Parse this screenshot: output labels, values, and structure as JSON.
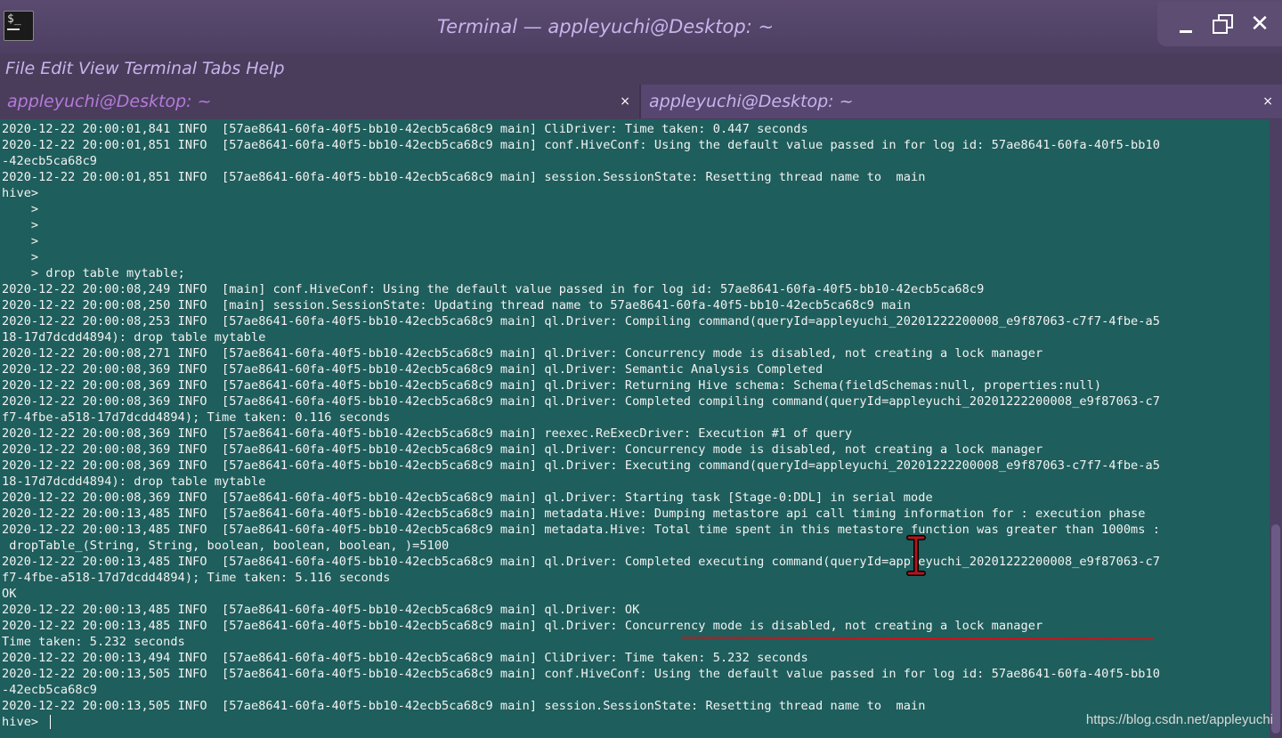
{
  "window": {
    "title": "Terminal — appleyuchi@Desktop: ~",
    "controls": {
      "minimize": "minimize",
      "maximize": "maximize",
      "close": "✕"
    }
  },
  "menu": [
    "File",
    "Edit",
    "View",
    "Terminal",
    "Tabs",
    "Help"
  ],
  "tabs": [
    {
      "label": "appleyuchi@Desktop: ~",
      "close": "×",
      "active": true
    },
    {
      "label": "appleyuchi@Desktop: ~",
      "close": "×",
      "active": false
    }
  ],
  "terminal": {
    "lines": [
      "2020-12-22 20:00:01,841 INFO  [57ae8641-60fa-40f5-bb10-42ecb5ca68c9 main] CliDriver: Time taken: 0.447 seconds",
      "2020-12-22 20:00:01,851 INFO  [57ae8641-60fa-40f5-bb10-42ecb5ca68c9 main] conf.HiveConf: Using the default value passed in for log id: 57ae8641-60fa-40f5-bb10",
      "-42ecb5ca68c9",
      "2020-12-22 20:00:01,851 INFO  [57ae8641-60fa-40f5-bb10-42ecb5ca68c9 main] session.SessionState: Resetting thread name to  main",
      "hive>",
      "    >",
      "    >",
      "    >",
      "    >",
      "    > drop table mytable;",
      "2020-12-22 20:00:08,249 INFO  [main] conf.HiveConf: Using the default value passed in for log id: 57ae8641-60fa-40f5-bb10-42ecb5ca68c9",
      "2020-12-22 20:00:08,250 INFO  [main] session.SessionState: Updating thread name to 57ae8641-60fa-40f5-bb10-42ecb5ca68c9 main",
      "2020-12-22 20:00:08,253 INFO  [57ae8641-60fa-40f5-bb10-42ecb5ca68c9 main] ql.Driver: Compiling command(queryId=appleyuchi_20201222200008_e9f87063-c7f7-4fbe-a5",
      "18-17d7dcdd4894): drop table mytable",
      "2020-12-22 20:00:08,271 INFO  [57ae8641-60fa-40f5-bb10-42ecb5ca68c9 main] ql.Driver: Concurrency mode is disabled, not creating a lock manager",
      "2020-12-22 20:00:08,369 INFO  [57ae8641-60fa-40f5-bb10-42ecb5ca68c9 main] ql.Driver: Semantic Analysis Completed",
      "2020-12-22 20:00:08,369 INFO  [57ae8641-60fa-40f5-bb10-42ecb5ca68c9 main] ql.Driver: Returning Hive schema: Schema(fieldSchemas:null, properties:null)",
      "2020-12-22 20:00:08,369 INFO  [57ae8641-60fa-40f5-bb10-42ecb5ca68c9 main] ql.Driver: Completed compiling command(queryId=appleyuchi_20201222200008_e9f87063-c7",
      "f7-4fbe-a518-17d7dcdd4894); Time taken: 0.116 seconds",
      "2020-12-22 20:00:08,369 INFO  [57ae8641-60fa-40f5-bb10-42ecb5ca68c9 main] reexec.ReExecDriver: Execution #1 of query",
      "2020-12-22 20:00:08,369 INFO  [57ae8641-60fa-40f5-bb10-42ecb5ca68c9 main] ql.Driver: Concurrency mode is disabled, not creating a lock manager",
      "2020-12-22 20:00:08,369 INFO  [57ae8641-60fa-40f5-bb10-42ecb5ca68c9 main] ql.Driver: Executing command(queryId=appleyuchi_20201222200008_e9f87063-c7f7-4fbe-a5",
      "18-17d7dcdd4894): drop table mytable",
      "2020-12-22 20:00:08,369 INFO  [57ae8641-60fa-40f5-bb10-42ecb5ca68c9 main] ql.Driver: Starting task [Stage-0:DDL] in serial mode",
      "2020-12-22 20:00:13,485 INFO  [57ae8641-60fa-40f5-bb10-42ecb5ca68c9 main] metadata.Hive: Dumping metastore api call timing information for : execution phase",
      "2020-12-22 20:00:13,485 INFO  [57ae8641-60fa-40f5-bb10-42ecb5ca68c9 main] metadata.Hive: Total time spent in this metastore function was greater than 1000ms :",
      " dropTable_(String, String, boolean, boolean, boolean, )=5100",
      "2020-12-22 20:00:13,485 INFO  [57ae8641-60fa-40f5-bb10-42ecb5ca68c9 main] ql.Driver: Completed executing command(queryId=appleyuchi_20201222200008_e9f87063-c7",
      "f7-4fbe-a518-17d7dcdd4894); Time taken: 5.116 seconds",
      "OK",
      "2020-12-22 20:00:13,485 INFO  [57ae8641-60fa-40f5-bb10-42ecb5ca68c9 main] ql.Driver: OK",
      "2020-12-22 20:00:13,485 INFO  [57ae8641-60fa-40f5-bb10-42ecb5ca68c9 main] ql.Driver: Concurrency mode is disabled, not creating a lock manager",
      "Time taken: 5.232 seconds",
      "2020-12-22 20:00:13,494 INFO  [57ae8641-60fa-40f5-bb10-42ecb5ca68c9 main] CliDriver: Time taken: 5.232 seconds",
      "2020-12-22 20:00:13,505 INFO  [57ae8641-60fa-40f5-bb10-42ecb5ca68c9 main] conf.HiveConf: Using the default value passed in for log id: 57ae8641-60fa-40f5-bb10",
      "-42ecb5ca68c9",
      "2020-12-22 20:00:13,505 INFO  [57ae8641-60fa-40f5-bb10-42ecb5ca68c9 main] session.SessionState: Resetting thread name to  main",
      "hive> "
    ]
  },
  "watermark": "https://blog.csdn.net/appleyuchi",
  "colors": {
    "chrome": "#4a3d5c",
    "title_text": "#c9b3ec",
    "active_tab_text": "#b57ad9",
    "terminal_bg": "#1e5e5c",
    "terminal_fg": "#f2f2f2",
    "annotation": "#c4161c"
  }
}
